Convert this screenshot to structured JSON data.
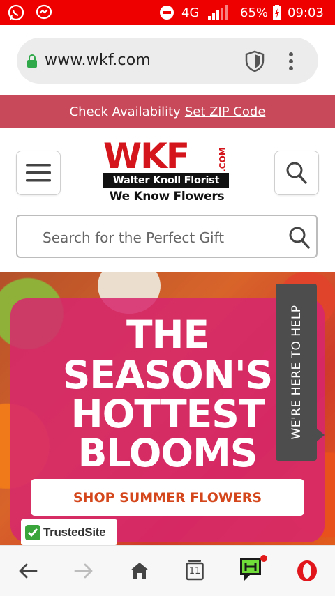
{
  "status_bar": {
    "network": "4G",
    "battery": "65%",
    "time": "09:03"
  },
  "browser": {
    "url": "www.wkf.com"
  },
  "zip_banner": {
    "text": "Check Availability",
    "link": "Set ZIP Code"
  },
  "logo": {
    "letters": "WKF",
    "com": ".COM",
    "name": "Walter Knoll Florist",
    "tagline": "We Know Flowers"
  },
  "search": {
    "placeholder": "Search for the Perfect Gift"
  },
  "hero": {
    "headline": [
      "THE",
      "SEASON'S",
      "HOTTEST",
      "BLOOMS"
    ],
    "cta": "SHOP SUMMER FLOWERS",
    "help_tab": "WE'RE HERE TO HELP",
    "trust_badge": "TrustedSite"
  },
  "bottom_nav": {
    "tab_count": "11"
  },
  "colors": {
    "status_bar": "#ee0000",
    "banner": "#c8495a",
    "brand_red": "#d4161c",
    "hero_card": "#d6266e",
    "cta_text": "#d4461b"
  },
  "icons": [
    "whatsapp-icon",
    "messenger-icon",
    "do-not-disturb-icon",
    "signal-icon",
    "battery-icon",
    "lock-icon",
    "shield-icon",
    "kebab-menu-icon",
    "hamburger-icon",
    "search-icon",
    "check-icon",
    "back-icon",
    "forward-icon",
    "home-icon",
    "tabs-icon",
    "hype-icon",
    "opera-icon"
  ]
}
